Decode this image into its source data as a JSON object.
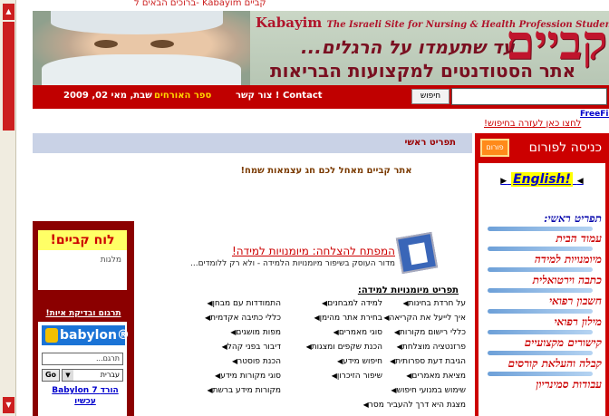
{
  "top_strip": "ברוכים הבאים ל- Kabayim קביים",
  "banner": {
    "english_title": "Kabayim",
    "english_tagline": "The Israeli Site for Nursing & Health Profession Students",
    "logo_hebrew": "קביים",
    "slogan": "עד שתעמדו על הרגלים...",
    "subtitle": "אתר הסטודנטים למקצועות הבריאות"
  },
  "navbar": {
    "date": "שבת, מאי 02, 2009",
    "guestbook": "ספר האורחים",
    "contact": "צור קשר ! Contact",
    "search_button": "חיפוש",
    "search_value": ""
  },
  "freefind": {
    "label": "FreeFind",
    "help": "לחצו כאן לעזרה בחיפוש!"
  },
  "main": {
    "menu_header": "תפריט ראשי",
    "greeting": "אתר קביים מאחל לכם חג עצמאות שמח!"
  },
  "sidebar": {
    "forum_entry": "כניסה לפורום",
    "forum_icon_text": "פורום",
    "english_link": "English!",
    "main_label": "תפריט ראשי:",
    "items": [
      "עמוד הבית",
      "מיומנויות למידה",
      "כתבה וירטואלית",
      "חשבון רפואי",
      "מילון רפואי",
      "קישורים מקצועיים",
      "קבלה והעלאת קורסים",
      "עבודות סמינריון"
    ]
  },
  "left": {
    "board_title": "לוח קביים!",
    "board_text": "מלגות",
    "translate_title": "תרגום ובדיקת איות!",
    "babylon_logo": "babylon",
    "translate_placeholder": "תרגם...",
    "go_button": "Go",
    "language": "עברית",
    "download_line1": "Babylon 7 הורד",
    "download_line2": "עכשיו"
  },
  "guide": {
    "title": "המפתח להצלחה: מיומנויות למידה!",
    "description": "מדור העוסק בשיפור מיומנויות הלמידה - ולא רק ללומדים...",
    "skills_title": "תפריט מיומנויות למידה:",
    "col1": [
      "על חרדת בחינות",
      "איך לייעל את הקריאה",
      "כללי רישום מקורות",
      "פרזנטציה מוצלחת",
      "הגיבת דעת ספרותית",
      "מציאת מאמרים",
      "שימוש במנועי חיפוש",
      "מצגת היא דרך להעביר מסר"
    ],
    "col2": [
      "למידה למבחנים",
      "בחירת אתר מהימן",
      "סוגי מאמרים",
      "הכנת שקפים ומצגות",
      "חיפוש מידע",
      "שיפור הזיכרון"
    ],
    "col3": [
      "התמודדות עם מבחן",
      "כללי כתיבה אקדמית",
      "מפות מושגים",
      "דיבור בפני קהל",
      "הכנת פוסטר",
      "סוגי מקורות מידע",
      "מקורות מידע ברשת"
    ]
  }
}
